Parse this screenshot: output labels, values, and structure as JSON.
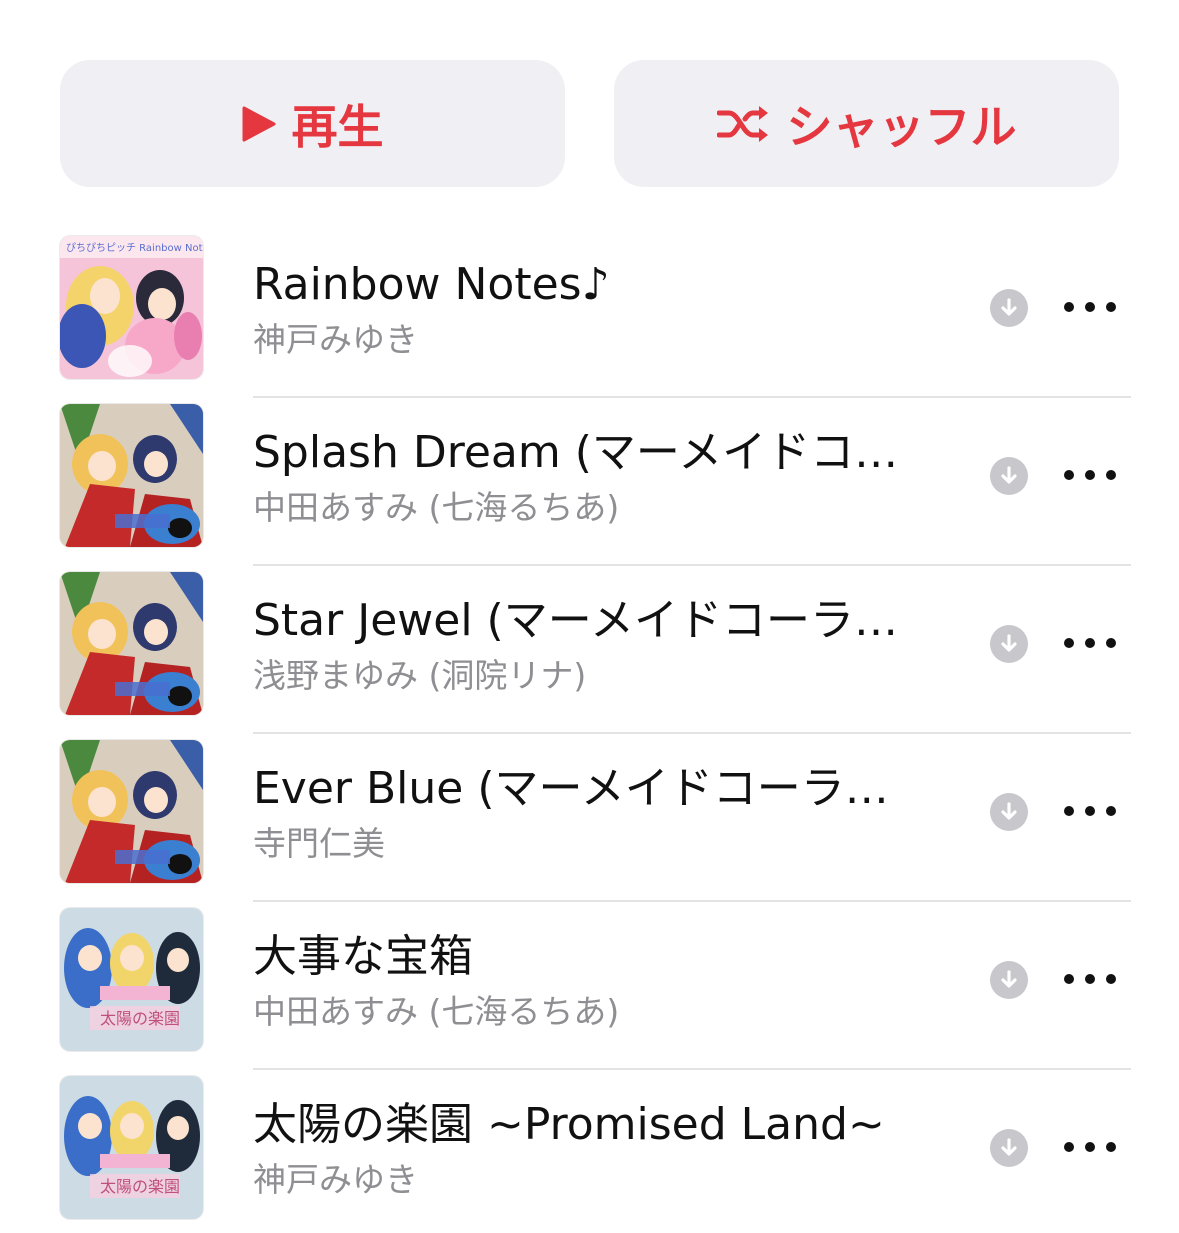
{
  "actions": {
    "play_label": "再生",
    "shuffle_label": "シャッフル",
    "accent_color": "#e5373f"
  },
  "tracks": [
    {
      "title": "Rainbow Notes♪",
      "artist": "神戸みゆき",
      "artwork": "album-art-rainbow-notes"
    },
    {
      "title": "Splash Dream (マーメイドコ…",
      "artist": "中田あすみ (七海るちあ)",
      "artwork": "album-art-christmas"
    },
    {
      "title": "Star Jewel (マーメイドコーラ…",
      "artist": "浅野まゆみ (洞院リナ)",
      "artwork": "album-art-christmas"
    },
    {
      "title": "Ever Blue (マーメイドコーラ…",
      "artist": "寺門仁美",
      "artwork": "album-art-christmas"
    },
    {
      "title": "大事な宝箱",
      "artist": "中田あすみ (七海るちあ)",
      "artwork": "album-art-taiyou-no-rakuen"
    },
    {
      "title": "太陽の楽園 ~Promised Land~",
      "artist": "神戸みゆき",
      "artwork": "album-art-taiyou-no-rakuen"
    }
  ],
  "icons": {
    "play": "play-icon",
    "shuffle": "shuffle-icon",
    "download": "download-icon",
    "more": "more-icon"
  }
}
